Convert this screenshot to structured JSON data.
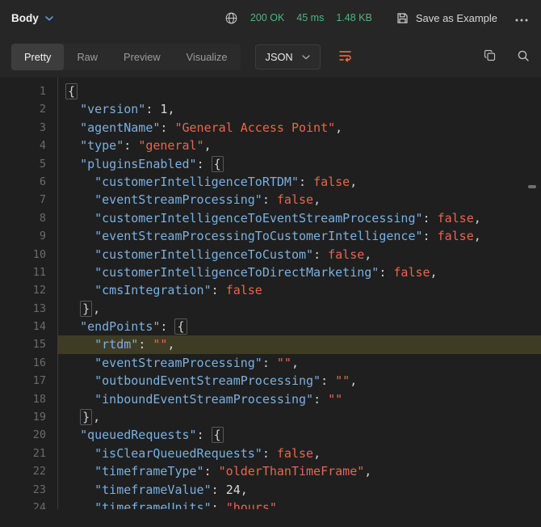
{
  "header": {
    "body_label": "Body",
    "status": "200 OK",
    "time": "45 ms",
    "size": "1.48 KB",
    "save_as_example": "Save as Example"
  },
  "toolbar": {
    "tabs": [
      "Pretty",
      "Raw",
      "Preview",
      "Visualize"
    ],
    "active_tab": "Pretty",
    "format": "JSON"
  },
  "icons": [
    "chevron-down-icon",
    "globe-icon",
    "save-icon",
    "more-options-icon",
    "wrap-lines-icon",
    "copy-icon",
    "search-icon"
  ],
  "colors": {
    "accent_orange": "#ff6e41",
    "status_green": "#4db780",
    "key_blue": "#7ab0e0",
    "string_red": "#e8664d",
    "highlight_line_bg": "#3f3c26"
  },
  "editor": {
    "language": "json",
    "highlighted_line": 15,
    "lines": [
      {
        "num": 1,
        "ind": 0,
        "tokens": [
          [
            "brace",
            "{"
          ]
        ]
      },
      {
        "num": 2,
        "ind": 2,
        "tokens": [
          [
            "key",
            "version"
          ],
          [
            "p",
            ": "
          ],
          [
            "num",
            "1"
          ],
          [
            "p",
            ","
          ]
        ]
      },
      {
        "num": 3,
        "ind": 2,
        "tokens": [
          [
            "key",
            "agentName"
          ],
          [
            "p",
            ": "
          ],
          [
            "str",
            "General Access Point"
          ],
          [
            "p",
            ","
          ]
        ]
      },
      {
        "num": 4,
        "ind": 2,
        "tokens": [
          [
            "key",
            "type"
          ],
          [
            "p",
            ": "
          ],
          [
            "str",
            "general"
          ],
          [
            "p",
            ","
          ]
        ]
      },
      {
        "num": 5,
        "ind": 2,
        "tokens": [
          [
            "key",
            "pluginsEnabled"
          ],
          [
            "p",
            ": "
          ],
          [
            "brace",
            "{"
          ]
        ]
      },
      {
        "num": 6,
        "ind": 4,
        "tokens": [
          [
            "key",
            "customerIntelligenceToRTDM"
          ],
          [
            "p",
            ": "
          ],
          [
            "bool",
            "false"
          ],
          [
            "p",
            ","
          ]
        ]
      },
      {
        "num": 7,
        "ind": 4,
        "tokens": [
          [
            "key",
            "eventStreamProcessing"
          ],
          [
            "p",
            ": "
          ],
          [
            "bool",
            "false"
          ],
          [
            "p",
            ","
          ]
        ]
      },
      {
        "num": 8,
        "ind": 4,
        "tokens": [
          [
            "key",
            "customerIntelligenceToEventStreamProcessing"
          ],
          [
            "p",
            ": "
          ],
          [
            "bool",
            "false"
          ],
          [
            "p",
            ","
          ]
        ]
      },
      {
        "num": 9,
        "ind": 4,
        "tokens": [
          [
            "key",
            "eventStreamProcessingToCustomerIntelligence"
          ],
          [
            "p",
            ": "
          ],
          [
            "bool",
            "false"
          ],
          [
            "p",
            ","
          ]
        ]
      },
      {
        "num": 10,
        "ind": 4,
        "tokens": [
          [
            "key",
            "customerIntelligenceToCustom"
          ],
          [
            "p",
            ": "
          ],
          [
            "bool",
            "false"
          ],
          [
            "p",
            ","
          ]
        ]
      },
      {
        "num": 11,
        "ind": 4,
        "tokens": [
          [
            "key",
            "customerIntelligenceToDirectMarketing"
          ],
          [
            "p",
            ": "
          ],
          [
            "bool",
            "false"
          ],
          [
            "p",
            ","
          ]
        ]
      },
      {
        "num": 12,
        "ind": 4,
        "tokens": [
          [
            "key",
            "cmsIntegration"
          ],
          [
            "p",
            ": "
          ],
          [
            "bool",
            "false"
          ]
        ]
      },
      {
        "num": 13,
        "ind": 2,
        "tokens": [
          [
            "brace",
            "}"
          ],
          [
            "p",
            ","
          ]
        ]
      },
      {
        "num": 14,
        "ind": 2,
        "tokens": [
          [
            "key",
            "endPoints"
          ],
          [
            "p",
            ": "
          ],
          [
            "brace",
            "{"
          ]
        ]
      },
      {
        "num": 15,
        "ind": 4,
        "tokens": [
          [
            "key",
            "rtdm"
          ],
          [
            "p",
            ": "
          ],
          [
            "str",
            ""
          ],
          [
            "p",
            ","
          ]
        ]
      },
      {
        "num": 16,
        "ind": 4,
        "tokens": [
          [
            "key",
            "eventStreamProcessing"
          ],
          [
            "p",
            ": "
          ],
          [
            "str",
            ""
          ],
          [
            "p",
            ","
          ]
        ]
      },
      {
        "num": 17,
        "ind": 4,
        "tokens": [
          [
            "key",
            "outboundEventStreamProcessing"
          ],
          [
            "p",
            ": "
          ],
          [
            "str",
            ""
          ],
          [
            "p",
            ","
          ]
        ]
      },
      {
        "num": 18,
        "ind": 4,
        "tokens": [
          [
            "key",
            "inboundEventStreamProcessing"
          ],
          [
            "p",
            ": "
          ],
          [
            "str",
            ""
          ]
        ]
      },
      {
        "num": 19,
        "ind": 2,
        "tokens": [
          [
            "brace",
            "}"
          ],
          [
            "p",
            ","
          ]
        ]
      },
      {
        "num": 20,
        "ind": 2,
        "tokens": [
          [
            "key",
            "queuedRequests"
          ],
          [
            "p",
            ": "
          ],
          [
            "brace",
            "{"
          ]
        ]
      },
      {
        "num": 21,
        "ind": 4,
        "tokens": [
          [
            "key",
            "isClearQueuedRequests"
          ],
          [
            "p",
            ": "
          ],
          [
            "bool",
            "false"
          ],
          [
            "p",
            ","
          ]
        ]
      },
      {
        "num": 22,
        "ind": 4,
        "tokens": [
          [
            "key",
            "timeframeType"
          ],
          [
            "p",
            ": "
          ],
          [
            "str",
            "olderThanTimeFrame"
          ],
          [
            "p",
            ","
          ]
        ]
      },
      {
        "num": 23,
        "ind": 4,
        "tokens": [
          [
            "key",
            "timeframeValue"
          ],
          [
            "p",
            ": "
          ],
          [
            "num",
            "24"
          ],
          [
            "p",
            ","
          ]
        ]
      },
      {
        "num": 24,
        "ind": 4,
        "tokens": [
          [
            "key",
            "timeframeUnits"
          ],
          [
            "p",
            ": "
          ],
          [
            "str",
            "hours"
          ],
          [
            "p",
            ","
          ]
        ]
      }
    ]
  }
}
